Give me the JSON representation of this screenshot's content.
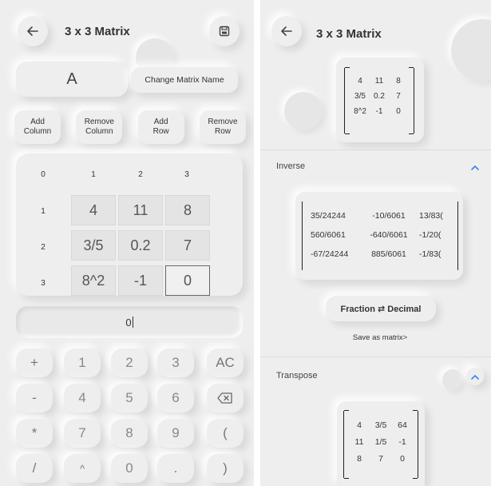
{
  "colors": {
    "panel_bg": "#eeeeee",
    "accent": "#3b82f6",
    "text": "#333333"
  },
  "editor": {
    "title": "3 x 3 Matrix",
    "back_icon": "arrow-left-icon",
    "save_icon": "save-icon",
    "matrix_name": "A",
    "change_name_label": "Change Matrix Name",
    "ops": [
      {
        "line1": "Add",
        "line2": "Column"
      },
      {
        "line1": "Remove",
        "line2": "Column"
      },
      {
        "line1": "Add",
        "line2": "Row"
      },
      {
        "line1": "Remove",
        "line2": "Row"
      }
    ],
    "grid": {
      "col_headers": [
        "0",
        "1",
        "2",
        "3"
      ],
      "row_headers": [
        "1",
        "2",
        "3"
      ],
      "cells": [
        [
          "4",
          "11",
          "8"
        ],
        [
          "3/5",
          "0.2",
          "7"
        ],
        [
          "8^2",
          "-1",
          "0"
        ]
      ]
    },
    "input_value": "0",
    "keypad": [
      [
        "+",
        "1",
        "2",
        "3",
        "AC"
      ],
      [
        "-",
        "4",
        "5",
        "6",
        "⌫"
      ],
      [
        "*",
        "7",
        "8",
        "9",
        "("
      ],
      [
        "/",
        "^",
        "0",
        ".",
        ")"
      ]
    ]
  },
  "result": {
    "title": "3 x 3 Matrix",
    "back_icon": "arrow-left-icon",
    "original": [
      [
        "4",
        "11",
        "8"
      ],
      [
        "3/5",
        "0.2",
        "7"
      ],
      [
        "8^2",
        "-1",
        "0"
      ]
    ],
    "inverse": {
      "label": "Inverse",
      "rows": [
        [
          "35/24244",
          "-10/6061",
          "13/83("
        ],
        [
          "560/6061",
          "-640/6061",
          "-1/20("
        ],
        [
          "-67/24244",
          "885/6061",
          "-1/83("
        ]
      ],
      "toggle_label": "Fraction ⇄ Decimal",
      "save_label": "Save as matrix>"
    },
    "transpose": {
      "label": "Transpose",
      "rows": [
        [
          "4",
          "3/5",
          "64"
        ],
        [
          "11",
          "1/5",
          "-1"
        ],
        [
          "8",
          "7",
          "0"
        ]
      ]
    }
  }
}
